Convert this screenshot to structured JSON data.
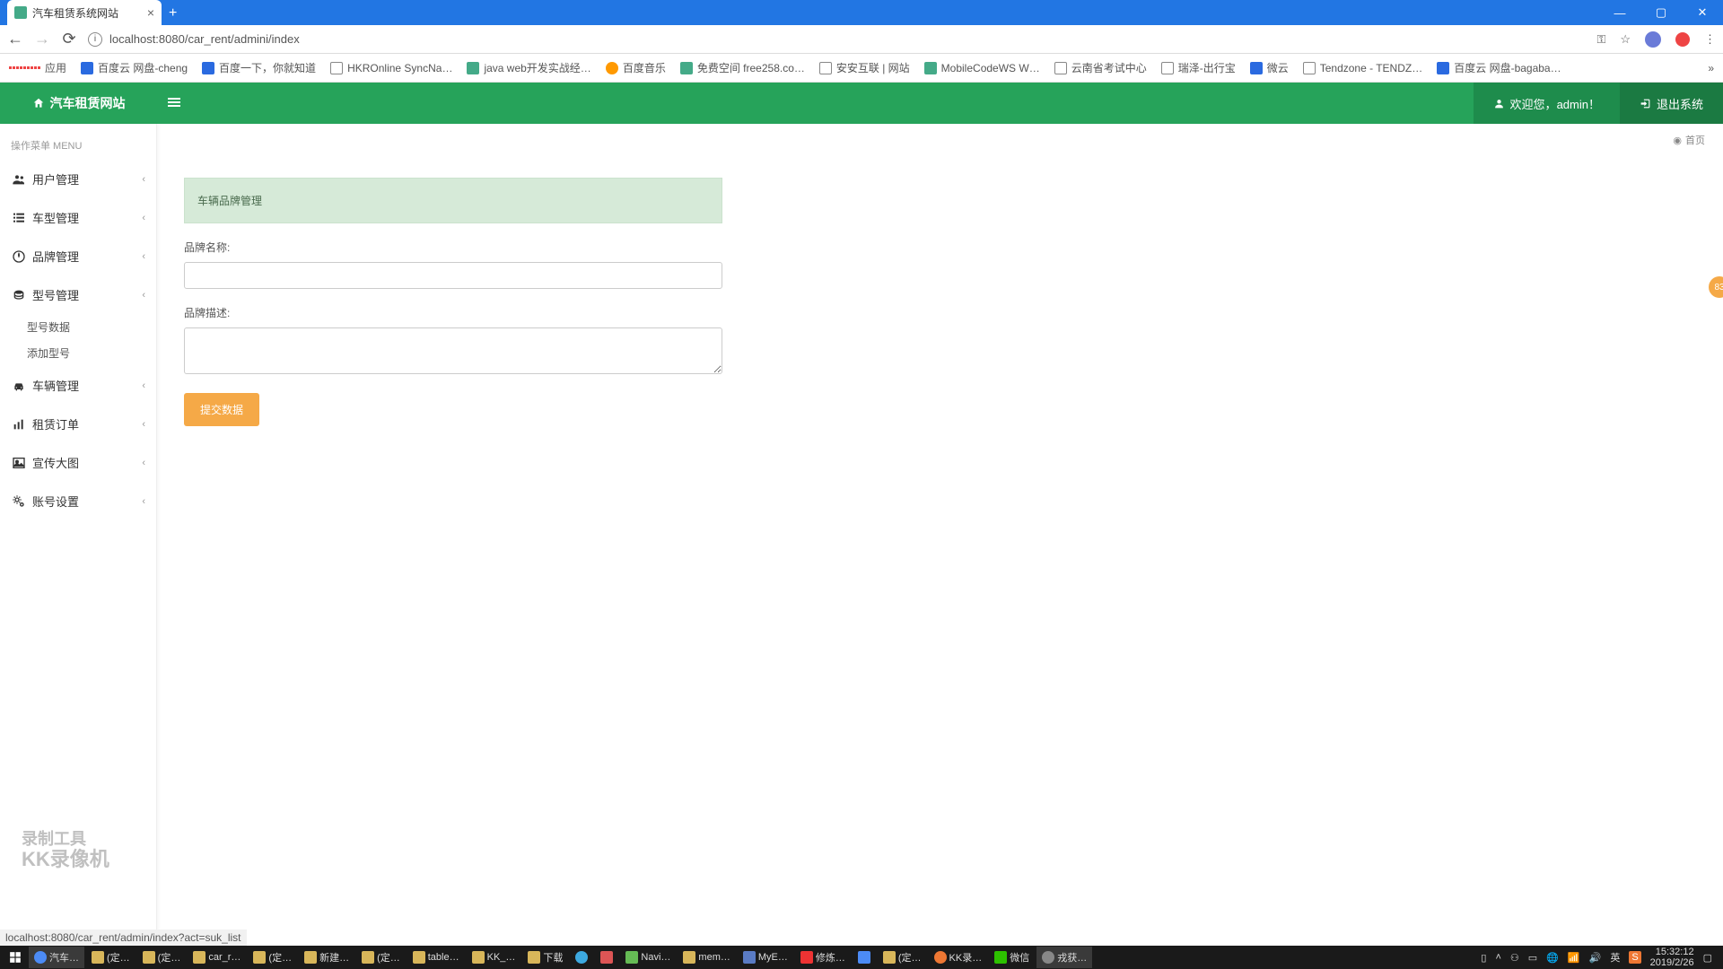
{
  "browser": {
    "tab_title": "汽车租赁系统网站",
    "url": "localhost:8080/car_rent/admini/index",
    "window_controls": {
      "min": "—",
      "max": "▢",
      "close": "✕"
    },
    "address_icons": {
      "key": "⚿",
      "star": "☆",
      "more": "⋮"
    }
  },
  "bookmarks": {
    "apps": "应用",
    "items": [
      "百度云 网盘-cheng",
      "百度一下，你就知道",
      "HKROnline SyncNa…",
      "java web开发实战经…",
      "百度音乐",
      "免费空间 free258.co…",
      "安安互联 | 网站",
      "MobileCodeWS W…",
      "云南省考试中心",
      "瑞泽-出行宝",
      "微云",
      "Tendzone - TENDZ…",
      "百度云 网盘-bagaba…"
    ],
    "more": "»"
  },
  "header": {
    "brand": "汽车租赁网站",
    "welcome_prefix": "欢迎您，",
    "username": "admin！",
    "logout": "退出系统"
  },
  "sidebar": {
    "menu_header": "操作菜单 MENU",
    "items": [
      {
        "label": "用户管理"
      },
      {
        "label": "车型管理"
      },
      {
        "label": "品牌管理"
      },
      {
        "label": "型号管理",
        "sub": [
          "型号数据",
          "添加型号"
        ]
      },
      {
        "label": "车辆管理"
      },
      {
        "label": "租赁订单"
      },
      {
        "label": "宣传大图"
      },
      {
        "label": "账号设置"
      }
    ]
  },
  "breadcrumb": {
    "home": "首页"
  },
  "panel": {
    "title": "车辆品牌管理",
    "field_name_label": "品牌名称:",
    "field_desc_label": "品牌描述:",
    "submit": "提交数据"
  },
  "recorder": {
    "line1": "录制工具",
    "line2": "KK录像机"
  },
  "float_badge": "83",
  "status_url": "localhost:8080/car_rent/admin/index?act=suk_list",
  "taskbar": {
    "items": [
      "汽车…",
      "(定…",
      "(定…",
      "car_r…",
      "(定…",
      "新建…",
      "(定…",
      "table…",
      "KK_…",
      "下载",
      "",
      "",
      "Navi…",
      "mem…",
      "MyE…",
      "修炼…",
      "",
      "(定…",
      "KK录…",
      "微信",
      "戎获…"
    ],
    "clock_time": "15:32:12",
    "clock_date": "2019/2/26"
  }
}
